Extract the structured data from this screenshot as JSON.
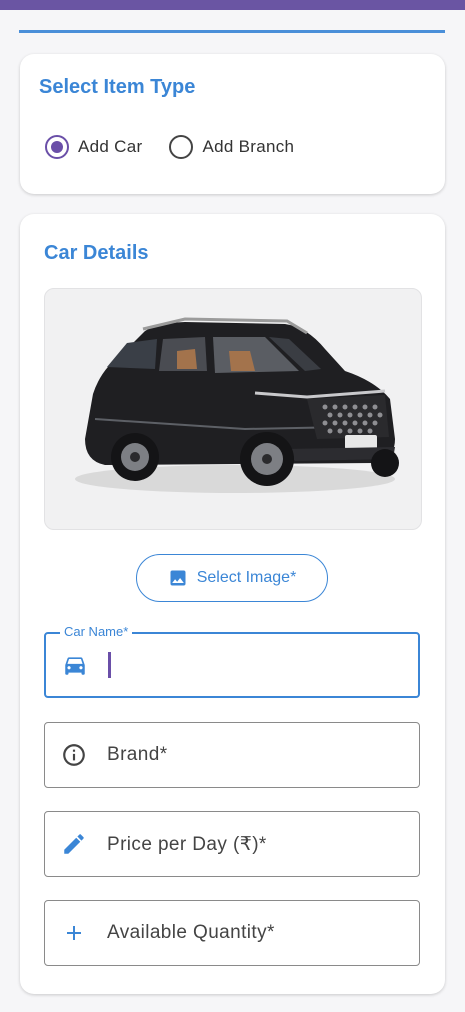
{
  "item_type": {
    "title": "Select Item Type",
    "options": [
      {
        "label": "Add Car",
        "checked": true
      },
      {
        "label": "Add Branch",
        "checked": false
      }
    ]
  },
  "car_details": {
    "title": "Car Details",
    "select_image_label": "Select Image*",
    "fields": {
      "car_name": {
        "label": "Car Name*",
        "value": ""
      },
      "brand": {
        "label": "Brand*"
      },
      "price": {
        "label": "Price per Day (₹)*"
      },
      "quantity": {
        "label": "Available Quantity*"
      }
    }
  },
  "colors": {
    "accent": "#3b86d6",
    "radio": "#6a4fa8",
    "topbar": "#6a55a3"
  },
  "icons": [
    "car-icon",
    "info-icon",
    "pencil-icon",
    "plus-icon",
    "image-icon"
  ]
}
